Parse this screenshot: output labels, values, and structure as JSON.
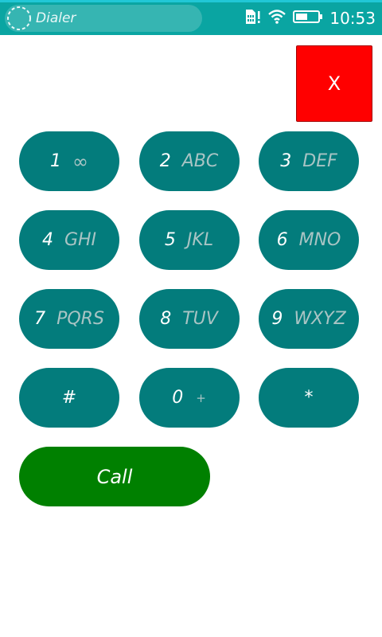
{
  "status_bar": {
    "app_title": "Dialer",
    "time": "10:53",
    "icons": [
      "sim-alert-icon",
      "wifi-icon",
      "battery-icon"
    ]
  },
  "number_display": {
    "value": ""
  },
  "clear_button": {
    "label": "X"
  },
  "keypad": [
    {
      "digit": "1",
      "letters": "∞"
    },
    {
      "digit": "2",
      "letters": "ABC"
    },
    {
      "digit": "3",
      "letters": "DEF"
    },
    {
      "digit": "4",
      "letters": "GHI"
    },
    {
      "digit": "5",
      "letters": "JKL"
    },
    {
      "digit": "6",
      "letters": "MNO"
    },
    {
      "digit": "7",
      "letters": "PQRS"
    },
    {
      "digit": "8",
      "letters": "TUV"
    },
    {
      "digit": "9",
      "letters": "WXYZ"
    },
    {
      "digit": "#",
      "letters": ""
    },
    {
      "digit": "0",
      "letters": "+"
    },
    {
      "digit": "*",
      "letters": ""
    }
  ],
  "call_button": {
    "label": "Call"
  },
  "colors": {
    "status_bar": "#0aa5a2",
    "key": "#037c7c",
    "call": "#008000",
    "clear": "#ff0000"
  }
}
